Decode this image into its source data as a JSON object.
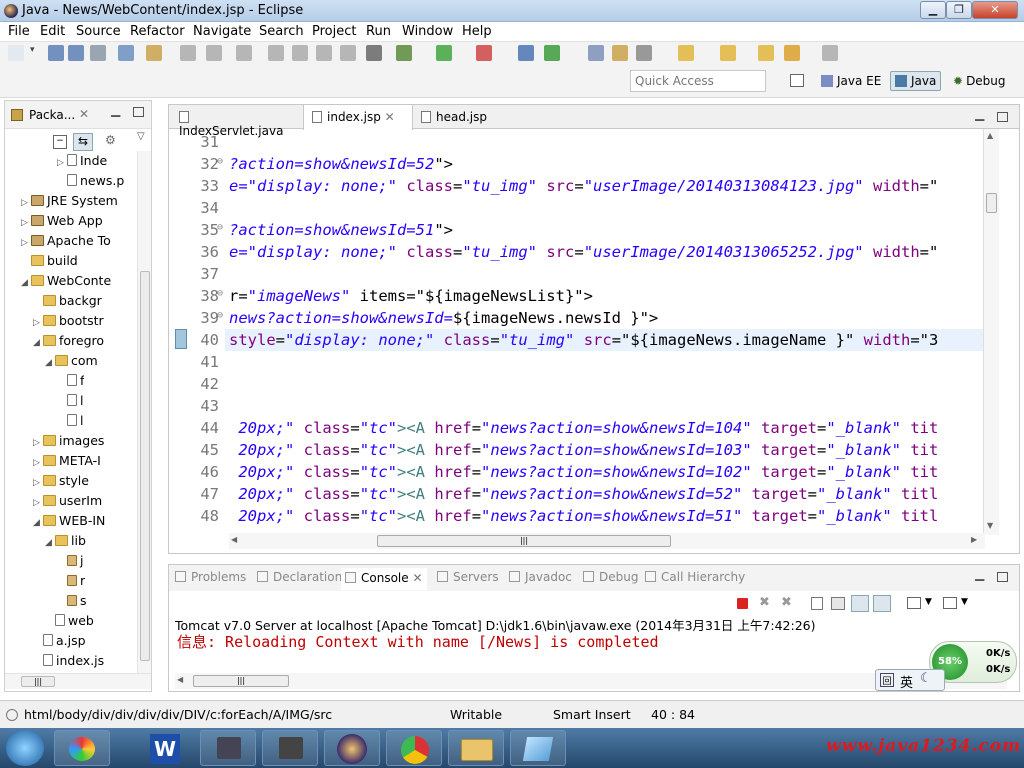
{
  "window": {
    "title": "Java - News/WebContent/index.jsp - Eclipse"
  },
  "menu": [
    "File",
    "Edit",
    "Source",
    "Refactor",
    "Navigate",
    "Search",
    "Project",
    "Run",
    "Window",
    "Help"
  ],
  "quick_access": {
    "placeholder": "Quick Access"
  },
  "perspectives": [
    "Java EE",
    "Java",
    "Debug"
  ],
  "package_explorer": {
    "tab": "Packa...",
    "items": [
      {
        "label": "Inde",
        "indent": 5,
        "icon": "java-file-icon",
        "expand": "collapsed"
      },
      {
        "label": "news.p",
        "indent": 5,
        "icon": "file-icon",
        "expand": "none"
      },
      {
        "label": "JRE System",
        "indent": 2,
        "icon": "library-icon",
        "expand": "collapsed"
      },
      {
        "label": "Web App",
        "indent": 2,
        "icon": "library-icon",
        "expand": "collapsed"
      },
      {
        "label": "Apache To",
        "indent": 2,
        "icon": "library-icon",
        "expand": "collapsed"
      },
      {
        "label": "build",
        "indent": 2,
        "icon": "folder-icon",
        "expand": "none"
      },
      {
        "label": "WebConte",
        "indent": 2,
        "icon": "folder-icon",
        "expand": "expanded"
      },
      {
        "label": "backgr",
        "indent": 3,
        "icon": "folder-icon",
        "expand": "none"
      },
      {
        "label": "bootstr",
        "indent": 3,
        "icon": "folder-icon",
        "expand": "collapsed"
      },
      {
        "label": "foregro",
        "indent": 3,
        "icon": "folder-icon",
        "expand": "expanded"
      },
      {
        "label": "com",
        "indent": 4,
        "icon": "folder-icon",
        "expand": "expanded"
      },
      {
        "label": "f",
        "indent": 5,
        "icon": "file-icon",
        "expand": "none"
      },
      {
        "label": "l",
        "indent": 5,
        "icon": "file-icon",
        "expand": "none"
      },
      {
        "label": "l",
        "indent": 5,
        "icon": "file-icon",
        "expand": "none"
      },
      {
        "label": "images",
        "indent": 3,
        "icon": "folder-icon",
        "expand": "collapsed"
      },
      {
        "label": "META-I",
        "indent": 3,
        "icon": "folder-icon",
        "expand": "collapsed"
      },
      {
        "label": "style",
        "indent": 3,
        "icon": "folder-icon",
        "expand": "collapsed"
      },
      {
        "label": "userIm",
        "indent": 3,
        "icon": "folder-icon",
        "expand": "collapsed"
      },
      {
        "label": "WEB-IN",
        "indent": 3,
        "icon": "folder-icon",
        "expand": "expanded"
      },
      {
        "label": "lib",
        "indent": 4,
        "icon": "folder-icon",
        "expand": "expanded"
      },
      {
        "label": "j",
        "indent": 5,
        "icon": "jar-icon",
        "expand": "none"
      },
      {
        "label": "r",
        "indent": 5,
        "icon": "jar-icon",
        "expand": "none"
      },
      {
        "label": "s",
        "indent": 5,
        "icon": "jar-icon",
        "expand": "none"
      },
      {
        "label": "web",
        "indent": 4,
        "icon": "xml-file-icon",
        "expand": "none"
      },
      {
        "label": "a.jsp",
        "indent": 3,
        "icon": "file-icon",
        "expand": "none"
      },
      {
        "label": "index.js",
        "indent": 3,
        "icon": "file-icon",
        "expand": "none"
      }
    ]
  },
  "editor": {
    "tabs": [
      {
        "label": "IndexServlet.java",
        "active": false
      },
      {
        "label": "index.jsp",
        "active": true
      },
      {
        "label": "head.jsp",
        "active": false
      }
    ],
    "lines": [
      {
        "n": "31",
        "fold": false,
        "parts": []
      },
      {
        "n": "32",
        "fold": true,
        "parts": [
          [
            "s",
            "?action=show&newsId=52"
          ],
          [
            "t",
            "\">"
          ]
        ]
      },
      {
        "n": "33",
        "fold": false,
        "parts": [
          [
            "s",
            "e=\"display: none;\""
          ],
          [
            "t",
            " "
          ],
          [
            "a",
            "class"
          ],
          [
            "t",
            "="
          ],
          [
            "s",
            "\"tu_img\""
          ],
          [
            "t",
            " "
          ],
          [
            "a",
            "src"
          ],
          [
            "t",
            "="
          ],
          [
            "s",
            "\"userImage/20140313084123.jpg\""
          ],
          [
            "t",
            " "
          ],
          [
            "a",
            "width"
          ],
          [
            "t",
            "=\""
          ]
        ]
      },
      {
        "n": "34",
        "fold": false,
        "parts": []
      },
      {
        "n": "35",
        "fold": true,
        "parts": [
          [
            "s",
            "?action=show&newsId=51"
          ],
          [
            "t",
            "\">"
          ]
        ]
      },
      {
        "n": "36",
        "fold": false,
        "parts": [
          [
            "s",
            "e=\"display: none;\""
          ],
          [
            "t",
            " "
          ],
          [
            "a",
            "class"
          ],
          [
            "t",
            "="
          ],
          [
            "s",
            "\"tu_img\""
          ],
          [
            "t",
            " "
          ],
          [
            "a",
            "src"
          ],
          [
            "t",
            "="
          ],
          [
            "s",
            "\"userImage/20140313065252.jpg\""
          ],
          [
            "t",
            " "
          ],
          [
            "a",
            "width"
          ],
          [
            "t",
            "=\""
          ]
        ]
      },
      {
        "n": "37",
        "fold": false,
        "parts": []
      },
      {
        "n": "38",
        "fold": true,
        "parts": [
          [
            "t",
            "r="
          ],
          [
            "s",
            "\"imageNews\""
          ],
          [
            "t",
            " items=\"${imageNewsList}\">"
          ]
        ]
      },
      {
        "n": "39",
        "fold": true,
        "parts": [
          [
            "s",
            "news?action=show&newsId="
          ],
          [
            "t",
            "${imageNews.newsId }\">"
          ]
        ]
      },
      {
        "n": "40",
        "fold": false,
        "current": true,
        "parts": [
          [
            "a",
            "style"
          ],
          [
            "t",
            "="
          ],
          [
            "s",
            "\"display: none;\""
          ],
          [
            "t",
            " "
          ],
          [
            "a",
            "class"
          ],
          [
            "t",
            "="
          ],
          [
            "s",
            "\"tu_img\""
          ],
          [
            "t",
            " "
          ],
          [
            "a",
            "src"
          ],
          [
            "t",
            "=\"${imageNews.imageName }\" "
          ],
          [
            "a",
            "width"
          ],
          [
            "t",
            "=\"3"
          ]
        ]
      },
      {
        "n": "41",
        "fold": false,
        "parts": []
      },
      {
        "n": "42",
        "fold": false,
        "parts": []
      },
      {
        "n": "43",
        "fold": false,
        "parts": []
      },
      {
        "n": "44",
        "fold": false,
        "parts": [
          [
            "s",
            " 20px;\""
          ],
          [
            "t",
            " "
          ],
          [
            "a",
            "class"
          ],
          [
            "t",
            "="
          ],
          [
            "s",
            "\"tc\""
          ],
          [
            "tg",
            "><A"
          ],
          [
            "t",
            " "
          ],
          [
            "a",
            "href"
          ],
          [
            "t",
            "="
          ],
          [
            "s",
            "\"news?action=show&newsId=104\""
          ],
          [
            "t",
            " "
          ],
          [
            "a",
            "target"
          ],
          [
            "t",
            "="
          ],
          [
            "s",
            "\"_blank\""
          ],
          [
            "t",
            " "
          ],
          [
            "a",
            "tit"
          ]
        ]
      },
      {
        "n": "45",
        "fold": false,
        "parts": [
          [
            "s",
            " 20px;\""
          ],
          [
            "t",
            " "
          ],
          [
            "a",
            "class"
          ],
          [
            "t",
            "="
          ],
          [
            "s",
            "\"tc\""
          ],
          [
            "tg",
            "><A"
          ],
          [
            "t",
            " "
          ],
          [
            "a",
            "href"
          ],
          [
            "t",
            "="
          ],
          [
            "s",
            "\"news?action=show&newsId=103\""
          ],
          [
            "t",
            " "
          ],
          [
            "a",
            "target"
          ],
          [
            "t",
            "="
          ],
          [
            "s",
            "\"_blank\""
          ],
          [
            "t",
            " "
          ],
          [
            "a",
            "tit"
          ]
        ]
      },
      {
        "n": "46",
        "fold": false,
        "parts": [
          [
            "s",
            " 20px;\""
          ],
          [
            "t",
            " "
          ],
          [
            "a",
            "class"
          ],
          [
            "t",
            "="
          ],
          [
            "s",
            "\"tc\""
          ],
          [
            "tg",
            "><A"
          ],
          [
            "t",
            " "
          ],
          [
            "a",
            "href"
          ],
          [
            "t",
            "="
          ],
          [
            "s",
            "\"news?action=show&newsId=102\""
          ],
          [
            "t",
            " "
          ],
          [
            "a",
            "target"
          ],
          [
            "t",
            "="
          ],
          [
            "s",
            "\"_blank\""
          ],
          [
            "t",
            " "
          ],
          [
            "a",
            "tit"
          ]
        ]
      },
      {
        "n": "47",
        "fold": false,
        "parts": [
          [
            "s",
            " 20px;\""
          ],
          [
            "t",
            " "
          ],
          [
            "a",
            "class"
          ],
          [
            "t",
            "="
          ],
          [
            "s",
            "\"tc\""
          ],
          [
            "tg",
            "><A"
          ],
          [
            "t",
            " "
          ],
          [
            "a",
            "href"
          ],
          [
            "t",
            "="
          ],
          [
            "s",
            "\"news?action=show&newsId=52\""
          ],
          [
            "t",
            " "
          ],
          [
            "a",
            "target"
          ],
          [
            "t",
            "="
          ],
          [
            "s",
            "\"_blank\""
          ],
          [
            "t",
            " "
          ],
          [
            "a",
            "titl"
          ]
        ]
      },
      {
        "n": "48",
        "fold": false,
        "parts": [
          [
            "s",
            " 20px;\""
          ],
          [
            "t",
            " "
          ],
          [
            "a",
            "class"
          ],
          [
            "t",
            "="
          ],
          [
            "s",
            "\"tc\""
          ],
          [
            "tg",
            "><A"
          ],
          [
            "t",
            " "
          ],
          [
            "a",
            "href"
          ],
          [
            "t",
            "="
          ],
          [
            "s",
            "\"news?action=show&newsId=51\""
          ],
          [
            "t",
            " "
          ],
          [
            "a",
            "target"
          ],
          [
            "t",
            "="
          ],
          [
            "s",
            "\"_blank\""
          ],
          [
            "t",
            " "
          ],
          [
            "a",
            "titl"
          ]
        ]
      }
    ]
  },
  "console": {
    "tabs": [
      "Problems",
      "Declaration",
      "Console",
      "Servers",
      "Javadoc",
      "Debug",
      "Call Hierarchy"
    ],
    "server_line": "Tomcat v7.0 Server at localhost [Apache Tomcat] D:\\jdk1.6\\bin\\javaw.exe (2014年3月31日 上午7:42:26)",
    "output": "信息: Reloading Context with name [/News] is completed"
  },
  "net_widget": {
    "percent": "58%",
    "up": "0K/s",
    "down": "0K/s"
  },
  "ime": {
    "lang": "英"
  },
  "status": {
    "path": "html/body/div/div/div/div/DIV/c:forEach/A/IMG/src",
    "mode": "Writable",
    "insert": "Smart Insert",
    "pos": "40 : 84"
  },
  "watermark": "www.java1234.com",
  "colors": {
    "string": "#2a00ff",
    "attr": "#7f007f",
    "tag": "#3f7f7f",
    "error": "#c00000"
  }
}
